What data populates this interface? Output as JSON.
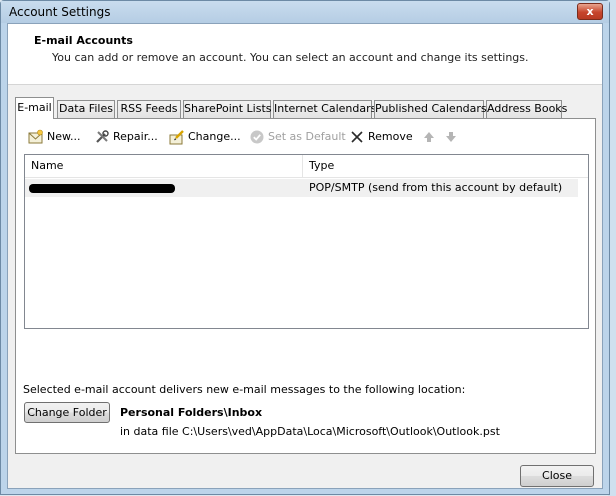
{
  "window": {
    "title": "Account Settings",
    "close_glyph": "x"
  },
  "header": {
    "title": "E-mail Accounts",
    "description": "You can add or remove an account. You can select an account and change its settings."
  },
  "tabs": [
    {
      "label": "E-mail",
      "active": true
    },
    {
      "label": "Data Files"
    },
    {
      "label": "RSS Feeds"
    },
    {
      "label": "SharePoint Lists"
    },
    {
      "label": "Internet Calendars"
    },
    {
      "label": "Published Calendars"
    },
    {
      "label": "Address Books"
    }
  ],
  "toolbar": {
    "new_label": "New...",
    "repair_label": "Repair...",
    "change_label": "Change...",
    "set_default_label": "Set as Default",
    "remove_label": "Remove"
  },
  "accounts_list": {
    "columns": [
      "Name",
      "Type"
    ],
    "rows": [
      {
        "type": "POP/SMTP (send from this account by default)"
      }
    ]
  },
  "delivery": {
    "text": "Selected e-mail account delivers new e-mail messages to the following location:",
    "change_folder_label": "Change Folder",
    "folder": "Personal Folders\\Inbox",
    "file_path": "in data file C:\\Users\\ved\\AppData\\Loca\\Microsoft\\Outlook\\Outlook.pst"
  },
  "footer": {
    "close_label": "Close"
  },
  "colors": {
    "accent": "#bcd4ea",
    "close_red": "#c6452c"
  }
}
